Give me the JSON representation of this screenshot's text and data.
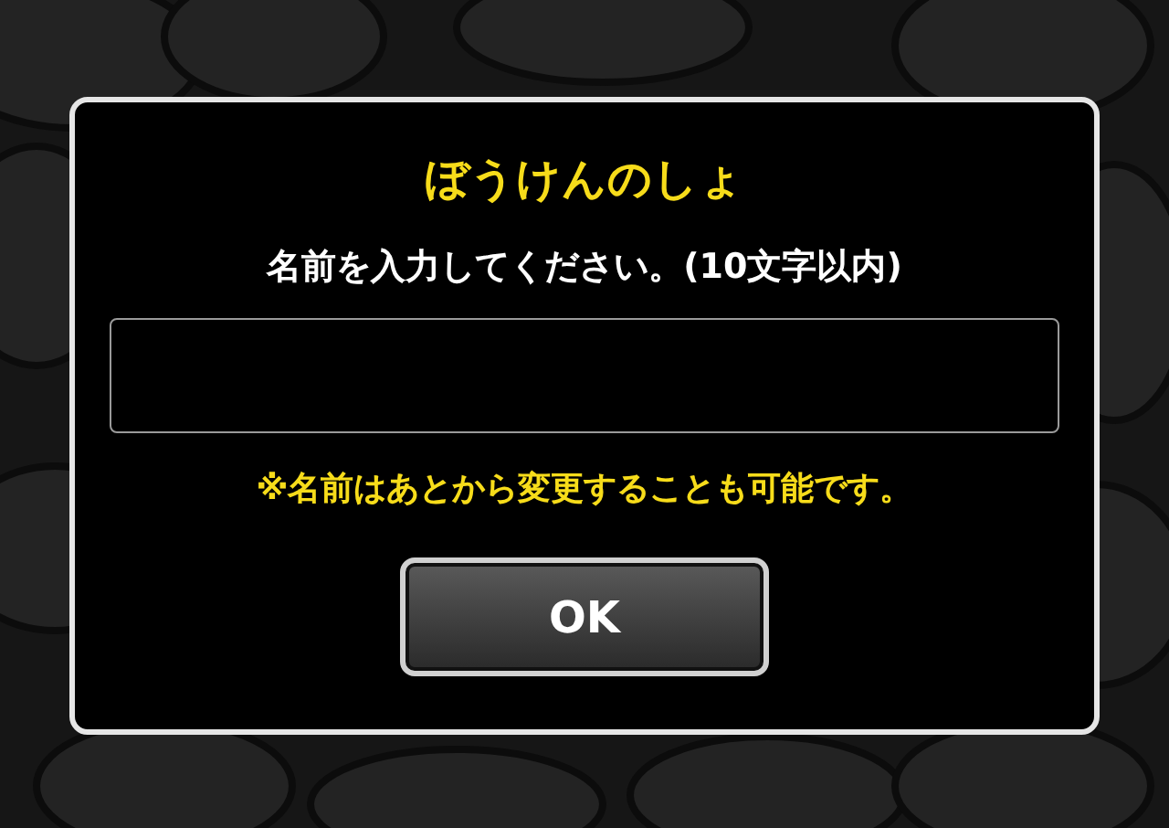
{
  "dialog": {
    "title": "ぼうけんのしょ",
    "prompt": "名前を入力してください。(10文字以内)",
    "note": "※名前はあとから変更することも可能です。",
    "buttons": [
      "OK"
    ]
  }
}
